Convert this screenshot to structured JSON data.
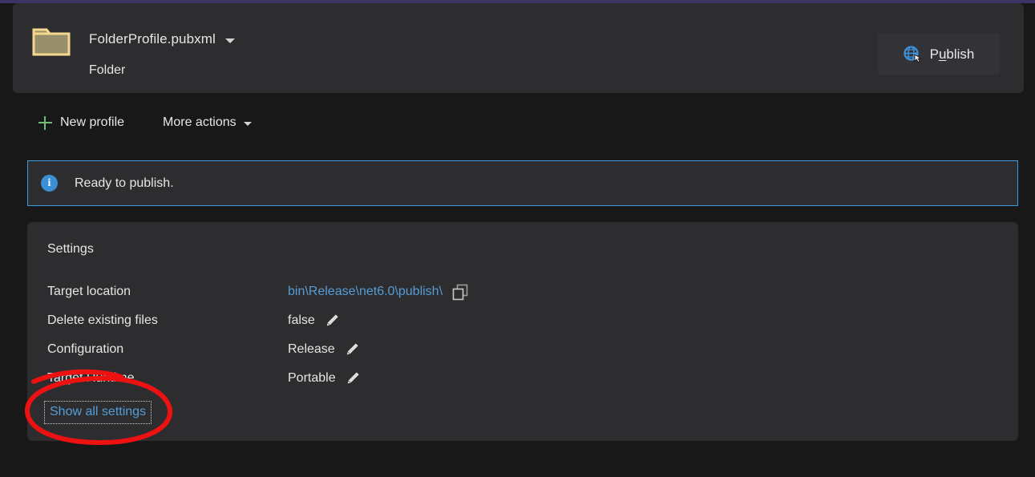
{
  "header": {
    "profile_name": "FolderProfile.pubxml",
    "profile_type": "Folder",
    "folder_icon": "folder-icon",
    "dropdown_icon": "chevron-down-icon",
    "publish": {
      "label_before": "P",
      "label_accel": "u",
      "label_after": "blish",
      "full_label": "Publish",
      "icon": "publish-globe-icon"
    }
  },
  "toolbar": {
    "new_profile_label": "New profile",
    "new_profile_icon": "plus-icon",
    "more_actions_label": "More actions",
    "more_actions_icon": "chevron-down-icon"
  },
  "banner": {
    "icon": "info-icon",
    "icon_glyph": "i",
    "message": "Ready to publish.",
    "border_color": "#3b9bdc",
    "icon_color": "#3b8fd4"
  },
  "settings": {
    "title": "Settings",
    "rows": [
      {
        "label": "Target location",
        "value": "bin\\Release\\net6.0\\publish\\",
        "value_kind": "link",
        "action_icon": "copy-icon"
      },
      {
        "label": "Delete existing files",
        "value": "false",
        "value_kind": "text",
        "action_icon": "pencil-icon"
      },
      {
        "label": "Configuration",
        "value": "Release",
        "value_kind": "text",
        "action_icon": "pencil-icon"
      },
      {
        "label": "Target Runtime",
        "value": "Portable",
        "value_kind": "text",
        "action_icon": "pencil-icon"
      }
    ],
    "show_all_label": "Show all settings",
    "show_all_focused": true
  },
  "annotation": {
    "shape": "ellipse",
    "color": "#ee1111",
    "target": "Show all settings"
  },
  "colors": {
    "window_background": "#181818",
    "panel_background": "#2d2d30",
    "chrome_accent": "#3b3564",
    "link": "#569cd6",
    "text": "#e6e6e6",
    "plus_green": "#6fbf73",
    "folder_fill": "#99906b",
    "folder_border": "#f5d88f"
  }
}
